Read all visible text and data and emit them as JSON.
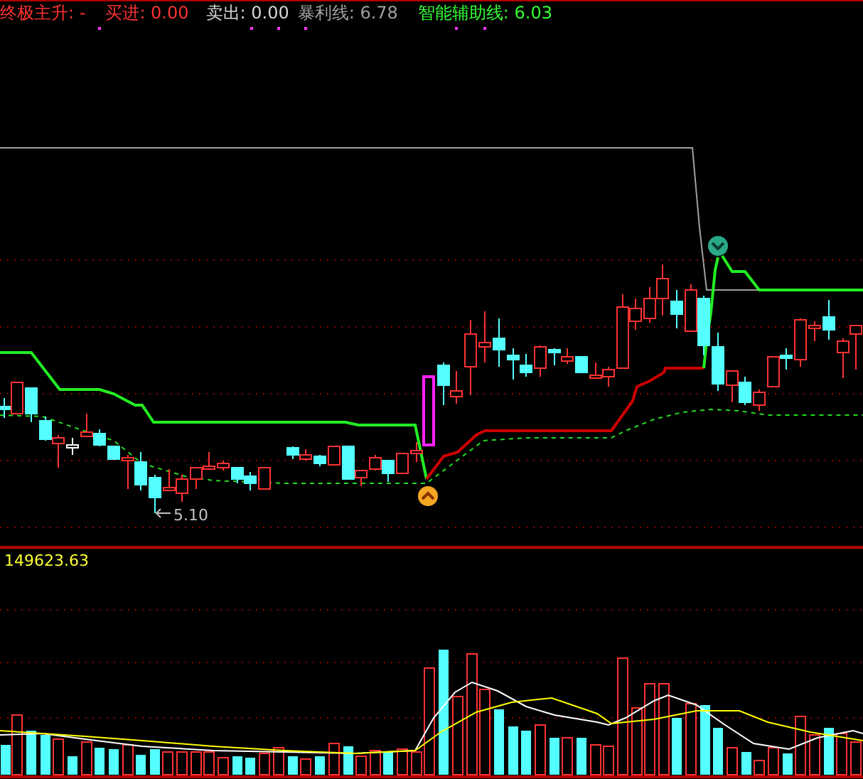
{
  "legend": [
    {
      "text": "终极主升: -",
      "color": "#ff3232"
    },
    {
      "text": "买进: 0.00",
      "color": "#ff3232"
    },
    {
      "text": "卖出: 0.00",
      "color": "#d8d8d8"
    },
    {
      "text": "暴利线: 6.78",
      "color": "#a0a0a0"
    },
    {
      "text": "智能辅助线: 6.03",
      "color": "#32ff32"
    }
  ],
  "price_chart": {
    "low_label": "5.10"
  },
  "volume_chart": {
    "label": "149623.63"
  }
}
